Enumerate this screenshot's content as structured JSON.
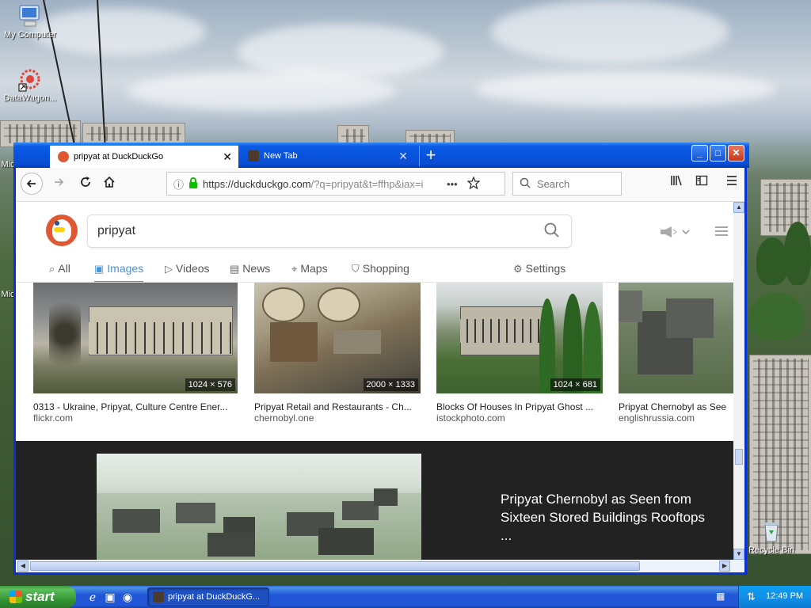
{
  "desktop": {
    "icons": [
      {
        "label": "My Computer"
      },
      {
        "label": "DataWagon..."
      },
      {
        "label": "Mic"
      },
      {
        "label": "Mic"
      },
      {
        "label": "Recycle Bin"
      }
    ]
  },
  "browser": {
    "tabs": [
      {
        "label": "pripyat at DuckDuckGo",
        "active": true
      },
      {
        "label": "New Tab",
        "active": false
      }
    ],
    "new_tab_glyph": "+",
    "close_glyph": "✕",
    "window_controls": {
      "minimize": "_",
      "maximize": "□",
      "close": "✕"
    },
    "url": {
      "main": "https://duckduckgo.com",
      "rest": "/?q=pripyat&t=ffhp&iax=i",
      "more": "•••"
    },
    "search_placeholder": "Search"
  },
  "page": {
    "query": "pripyat",
    "tabs": [
      {
        "label": "All",
        "icon": "search-icon"
      },
      {
        "label": "Images",
        "icon": "image-icon",
        "selected": true
      },
      {
        "label": "Videos",
        "icon": "play-icon"
      },
      {
        "label": "News",
        "icon": "news-icon"
      },
      {
        "label": "Maps",
        "icon": "map-pin-icon"
      },
      {
        "label": "Shopping",
        "icon": "bag-icon"
      }
    ],
    "settings_label": "Settings",
    "results": [
      {
        "title": "0313 - Ukraine, Pripyat, Culture Centre Ener...",
        "source": "flickr.com",
        "dims": "1024 × 576"
      },
      {
        "title": "Pripyat Retail and Restaurants - Ch...",
        "source": "chernobyl.one",
        "dims": "2000 × 1333"
      },
      {
        "title": "Blocks Of Houses In Pripyat Ghost ...",
        "source": "istockphoto.com",
        "dims": "1024 × 681"
      },
      {
        "title": "Pripyat Chernobyl as See",
        "source": "englishrussia.com",
        "dims": ""
      }
    ],
    "detail_title": "Pripyat Chernobyl as Seen from Sixteen Stored Buildings Rooftops ..."
  },
  "taskbar": {
    "start_label": "start",
    "task_label": "pripyat at DuckDuckG...",
    "clock": "12:49 PM"
  },
  "colors": {
    "xp_blue": "#0a5ce5",
    "ddg_orange": "#de5833",
    "ddg_link_blue": "#4495d4",
    "start_green": "#3c9a3c"
  }
}
